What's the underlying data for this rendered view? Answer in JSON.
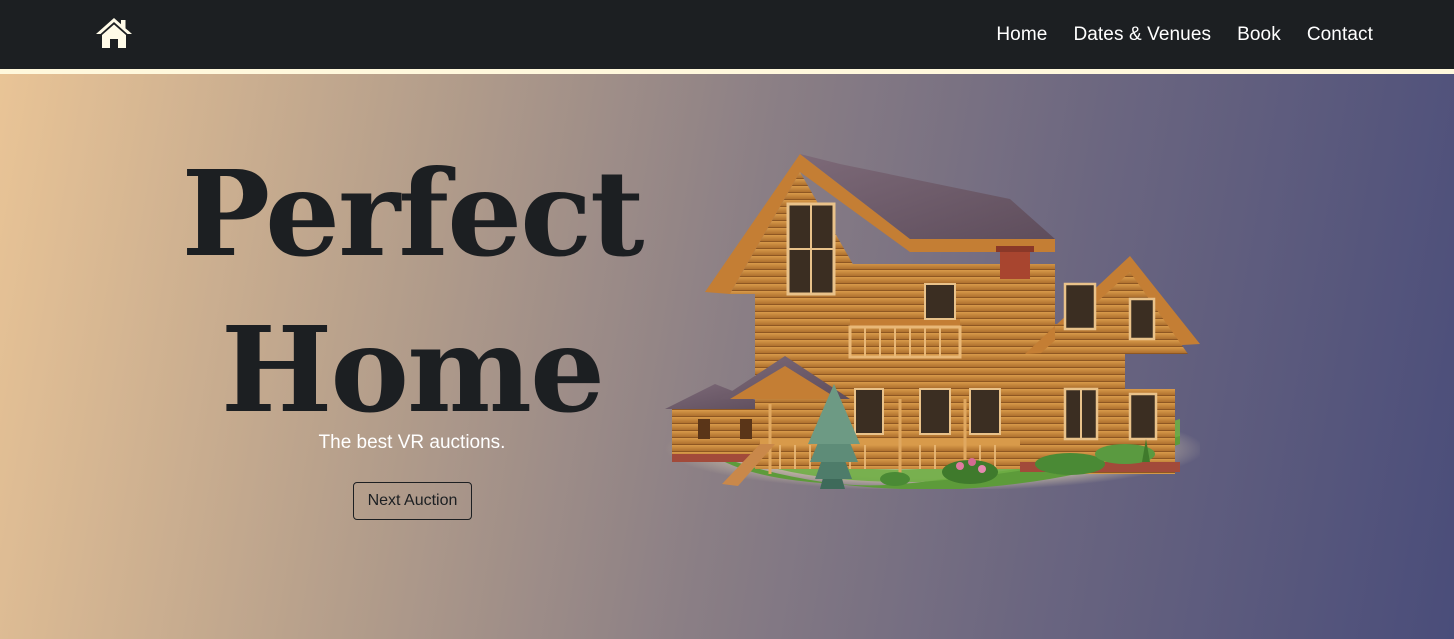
{
  "navbar": {
    "brand_icon": "home-icon",
    "links": [
      "Home",
      "Dates & Venues",
      "Book",
      "Contact"
    ]
  },
  "hero": {
    "headline_line1": "Perfect",
    "headline_line2": "Home",
    "tagline": "The best VR auctions.",
    "cta_label": "Next Auction",
    "image_subject": "log-cabin-house"
  },
  "colors": {
    "navbar_bg": "#1c1f22",
    "divider": "#fff8dc",
    "gradient_start": "#e9c496",
    "gradient_end": "#4a4d7a",
    "text_dark": "#1c1f22",
    "text_light": "#ffffff"
  }
}
